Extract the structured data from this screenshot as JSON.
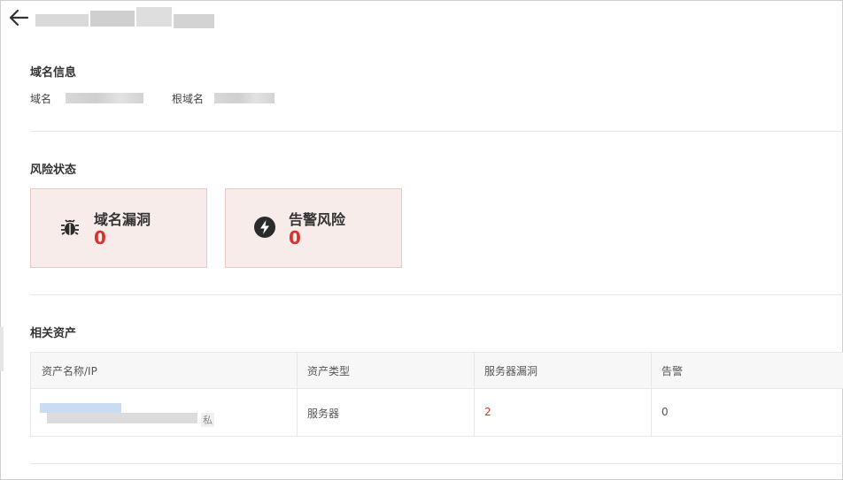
{
  "domain_info": {
    "title": "域名信息",
    "domain_label": "域名",
    "root_domain_label": "根域名"
  },
  "risk": {
    "title": "风险状态",
    "cards": [
      {
        "label": "域名漏洞",
        "count": "0",
        "icon": "bug-icon"
      },
      {
        "label": "告警风险",
        "count": "0",
        "icon": "lightning-icon"
      }
    ]
  },
  "assets": {
    "title": "相关资产",
    "columns": [
      "资产名称/IP",
      "资产类型",
      "服务器漏洞",
      "告警"
    ],
    "rows": [
      {
        "tag": "私",
        "type": "服务器",
        "vulns": "2",
        "alerts": "0"
      }
    ]
  },
  "colors": {
    "accent_red": "#d5332d",
    "card_bg": "#f8eceb",
    "card_border": "#e9c8c5"
  }
}
